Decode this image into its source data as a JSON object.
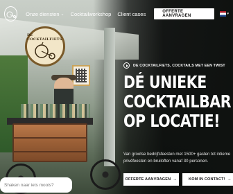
{
  "nav": {
    "items": [
      {
        "label": "Onze diensten",
        "dropdown": true
      },
      {
        "label": "Cocktailworkshop",
        "dropdown": false
      },
      {
        "label": "Client cases",
        "dropdown": false
      }
    ],
    "cta": "OFFERTE AANVRAGEN",
    "language_flag": "nl-flag-icon"
  },
  "sign": {
    "text": "DE COCKTAILFIETS"
  },
  "hero": {
    "tagline": "DE COCKTAILFIETS, COCKTAILS MET EEN TWIST",
    "headline": [
      "DÉ UNIEKE",
      "COCKTAILBAR",
      "OP LOCATIE!"
    ],
    "subtext": "Van grootse bedrijfsfeesten met 1500+ gasten tot intieme privéfeesten en bruiloften vanaf 30 personen.",
    "buttons": [
      {
        "label": "OFFERTE AANVRAGEN",
        "arrow": "→"
      },
      {
        "label": "KOM IN CONTACT!",
        "arrow": "→"
      }
    ]
  },
  "chat": {
    "placeholder": "Shaken naar iets moois?"
  },
  "colors": {
    "background": "#0f1210",
    "button_bg": "#ffffff",
    "button_text": "#111111"
  }
}
